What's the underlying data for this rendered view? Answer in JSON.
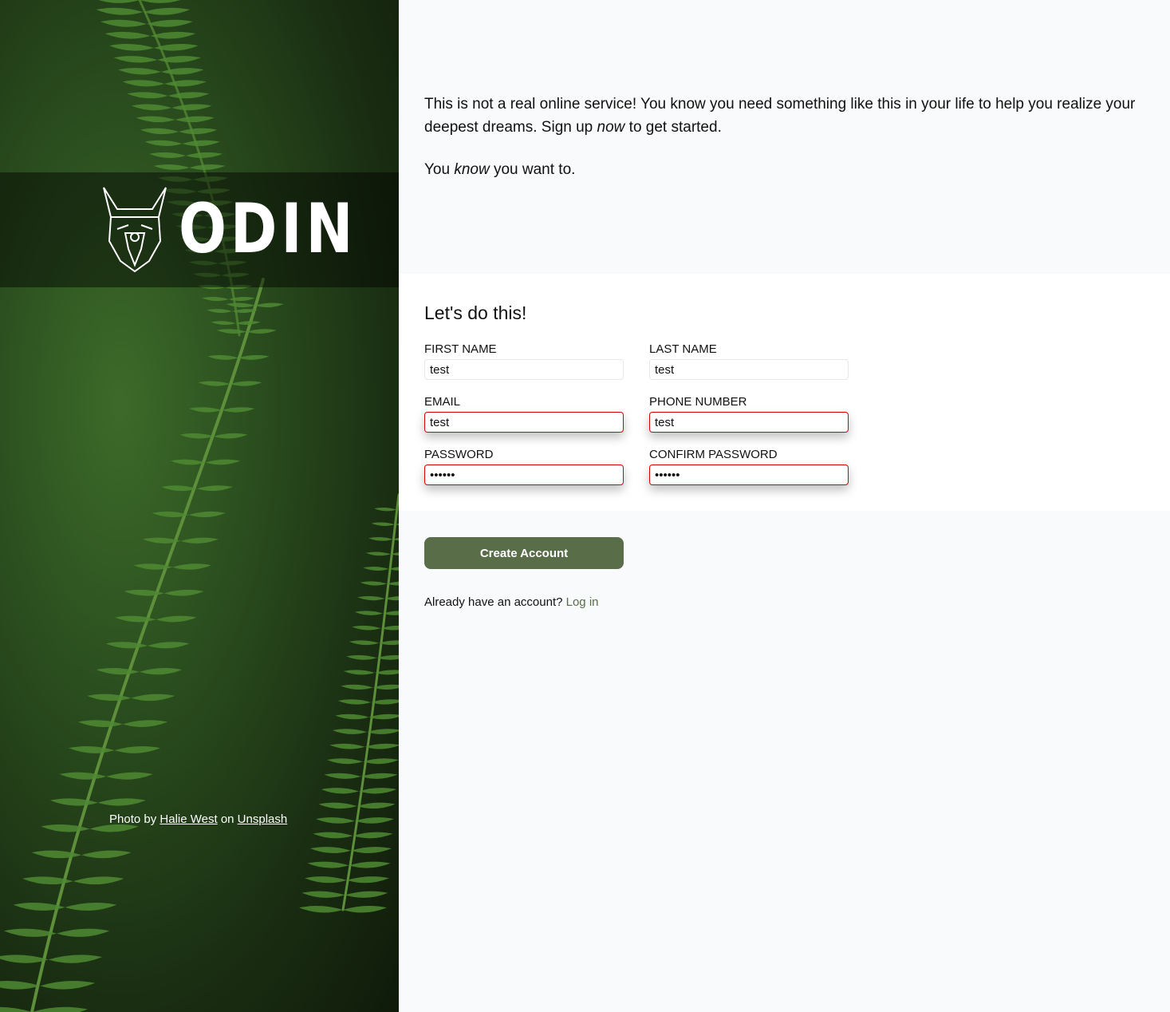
{
  "brand": {
    "name": "ODIN"
  },
  "credit": {
    "prefix": "Photo by",
    "author": "Halie West",
    "middle": "on",
    "site": "Unsplash"
  },
  "intro": {
    "p1_a": "This is not a real online service! You know you need something like this in your life to help you realize your deepest dreams. Sign up ",
    "p1_em": "now",
    "p1_b": " to get started.",
    "p2_a": "You ",
    "p2_em": "know",
    "p2_b": " you want to."
  },
  "form": {
    "title": "Let's do this!",
    "fields": [
      {
        "label": "FIRST NAME",
        "value": "test",
        "type": "text",
        "invalid": false
      },
      {
        "label": "LAST NAME",
        "value": "test",
        "type": "text",
        "invalid": false
      },
      {
        "label": "EMAIL",
        "value": "test",
        "type": "text",
        "invalid": true
      },
      {
        "label": "PHONE NUMBER",
        "value": "test",
        "type": "text",
        "invalid": true
      },
      {
        "label": "PASSWORD",
        "value": "......",
        "type": "password",
        "invalid": true
      },
      {
        "label": "CONFIRM PASSWORD",
        "value": "......",
        "type": "password",
        "invalid": true
      }
    ],
    "submit_label": "Create Account"
  },
  "login": {
    "prompt": "Already have an account?",
    "link": "Log in"
  },
  "colors": {
    "accent": "#596d48",
    "error": "#dd0000",
    "background": "#f9fafb"
  }
}
